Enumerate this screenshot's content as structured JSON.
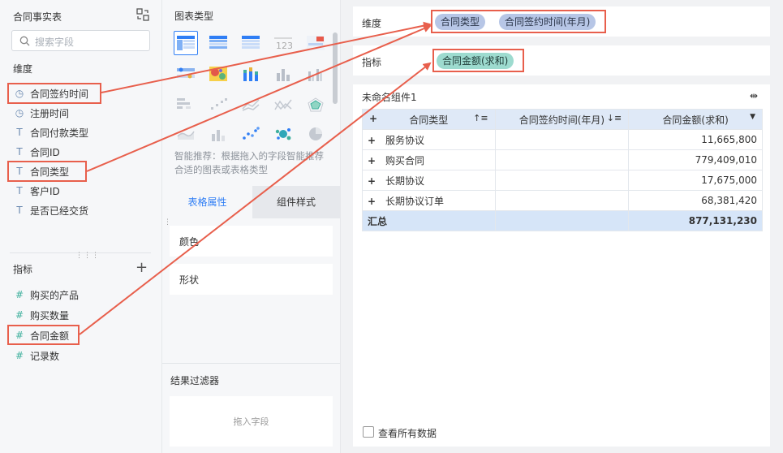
{
  "left": {
    "table_name": "合同事实表",
    "search_placeholder": "搜索字段",
    "dimension_header": "维度",
    "dimensions": [
      "合同签约时间",
      "注册时间",
      "合同付款类型",
      "合同ID",
      "合同类型",
      "客户ID",
      "是否已经交货"
    ],
    "measure_header": "指标",
    "measures": [
      "购买的产品",
      "购买数量",
      "合同金额",
      "记录数"
    ]
  },
  "middle": {
    "chart_type_header": "图表类型",
    "smart_text": "智能推荐：根据拖入的字段智能推荐合适的图表或表格类型",
    "tab_table_props": "表格属性",
    "tab_component_style": "组件样式",
    "prop_color": "颜色",
    "prop_shape": "形状",
    "filter_header": "结果过滤器",
    "drop_field": "拖入字段"
  },
  "right": {
    "dimension_label": "维度",
    "dimension_pills": [
      "合同类型",
      "合同签约时间(年月)"
    ],
    "measure_label": "指标",
    "measure_pills": [
      "合同金额(求和)"
    ],
    "component_title": "未命名组件1",
    "table": {
      "headers": [
        "合同类型",
        "合同签约时间(年月)",
        "合同金额(求和)"
      ],
      "rows": [
        [
          "服务协议",
          "",
          "11,665,800"
        ],
        [
          "购买合同",
          "",
          "779,409,010"
        ],
        [
          "长期协议",
          "",
          "17,675,000"
        ],
        [
          "长期协议订单",
          "",
          "68,381,420"
        ]
      ],
      "total_label": "汇总",
      "total_value": "877,131,230"
    },
    "view_all_label": "查看所有数据"
  },
  "colors": {
    "accent": "#2f7ef5",
    "highlight": "#e85f4c",
    "dim_pill": "#b7c6e6",
    "measure_pill": "#9ddbcf"
  }
}
